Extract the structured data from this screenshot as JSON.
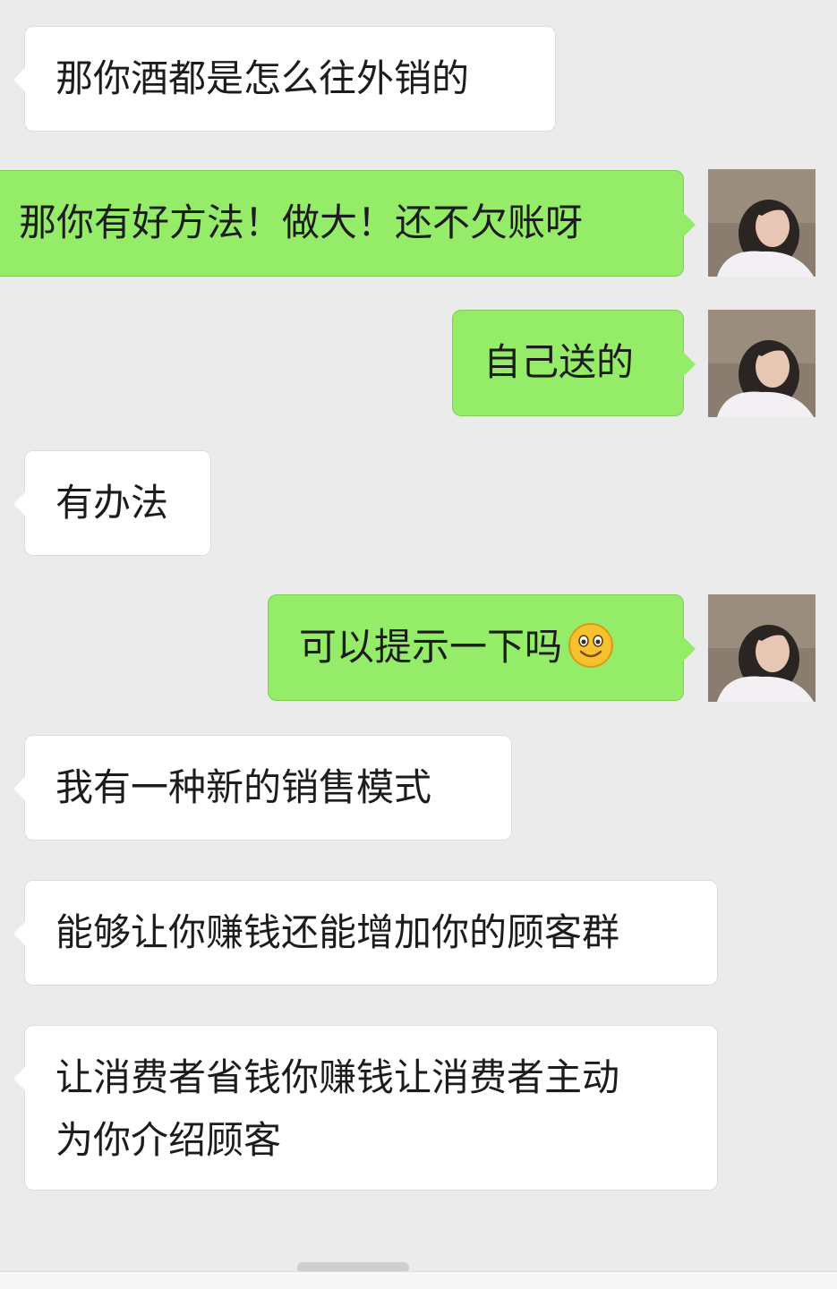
{
  "colors": {
    "background": "#ebebeb",
    "incoming_bubble": "#ffffff",
    "outgoing_bubble": "#95ec69"
  },
  "messages": [
    {
      "side": "incoming",
      "text": "那你酒都是怎么往外销的"
    },
    {
      "side": "outgoing",
      "text": "那你有好方法！做大！还不欠账呀",
      "avatar": "user-avatar"
    },
    {
      "side": "outgoing",
      "text": "自己送的",
      "avatar": "user-avatar"
    },
    {
      "side": "incoming",
      "text": "有办法"
    },
    {
      "side": "outgoing",
      "text": "可以提示一下吗",
      "emoji": "smile-emoji-icon",
      "avatar": "user-avatar"
    },
    {
      "side": "incoming",
      "text": "我有一种新的销售模式"
    },
    {
      "side": "incoming",
      "text": "能够让你赚钱还能增加你的顾客群"
    },
    {
      "side": "incoming",
      "lines": [
        "让消费者省钱你赚钱让消费者主动",
        "为你介绍顾客"
      ]
    }
  ]
}
